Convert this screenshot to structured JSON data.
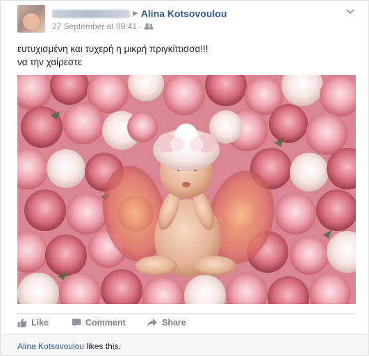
{
  "post": {
    "author_name_blurred": "",
    "target_name": "Alina Kotsovoulou",
    "timestamp": "27 September at 09:41",
    "separator": "·",
    "audience_icon": "friends-icon",
    "menu_icon": "chevron-down-icon",
    "text_line1": "ευτυχισμένη και τυχερή η μικρή πριγκίπισσα!!!",
    "text_line2": "να την χαίρεστε"
  },
  "actions": {
    "like_label": "Like",
    "comment_label": "Comment",
    "share_label": "Share"
  },
  "likes": {
    "liker_name": "Alina Kotsovoulou",
    "suffix": " likes this."
  },
  "colors": {
    "link": "#365899",
    "muted": "#90949c",
    "action": "#7f7f7f",
    "background": "#e9ebee"
  }
}
